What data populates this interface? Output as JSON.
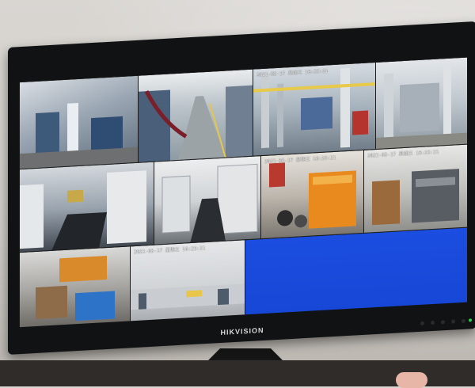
{
  "monitor": {
    "brand": "HIKVISION"
  },
  "cameras": [
    {
      "id": "cam-1",
      "osd": ""
    },
    {
      "id": "cam-2",
      "osd": ""
    },
    {
      "id": "cam-3",
      "osd": "2021-03-17 星期三 16:23:21"
    },
    {
      "id": "cam-4",
      "osd": ""
    },
    {
      "id": "cam-5",
      "osd": ""
    },
    {
      "id": "cam-6",
      "osd": ""
    },
    {
      "id": "cam-7",
      "osd": "2021-03-17 星期三 16:23:21"
    },
    {
      "id": "cam-8",
      "osd": "2021-03-17 星期三 16:23:21"
    },
    {
      "id": "cam-9",
      "osd": ""
    },
    {
      "id": "cam-10",
      "osd": "2021-03-17 星期三 16:23:21"
    },
    {
      "id": "cam-11",
      "osd": ""
    }
  ],
  "colors": {
    "bezel": "#111214",
    "empty_tile": "#1b4de0",
    "power_led": "#2bd14a"
  }
}
